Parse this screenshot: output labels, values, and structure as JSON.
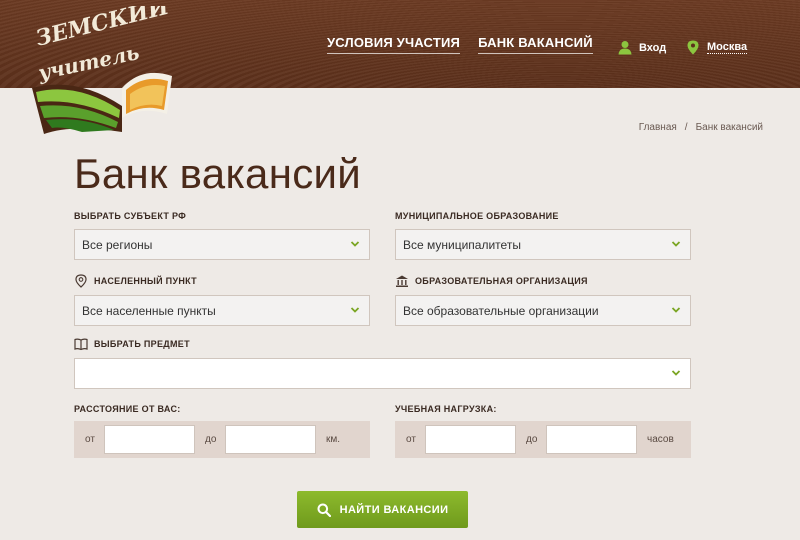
{
  "logo": {
    "text": "Земский учитель"
  },
  "nav": {
    "items": [
      "УСЛОВИЯ УЧАСТИЯ",
      "БАНК ВАКАНСИЙ"
    ]
  },
  "header": {
    "login": "Вход",
    "city": "Москва"
  },
  "breadcrumb": {
    "home": "Главная",
    "separator": "/",
    "current": "Банк вакансий"
  },
  "page_title": "Банк вакансий",
  "filters": {
    "region": {
      "label": "ВЫБРАТЬ СУБЪЕКТ РФ",
      "value": "Все регионы"
    },
    "municipality": {
      "label": "МУНИЦИПАЛЬНОЕ ОБРАЗОВАНИЕ",
      "value": "Все муниципалитеты"
    },
    "locality": {
      "label": "НАСЕЛЕННЫЙ ПУНКТ",
      "value": "Все населенные пункты"
    },
    "organization": {
      "label": "ОБРАЗОВАТЕЛЬНАЯ ОРГАНИЗАЦИЯ",
      "value": "Все образовательные организации"
    },
    "subject": {
      "label": "ВЫБРАТЬ ПРЕДМЕТ",
      "value": ""
    },
    "distance": {
      "label": "РАССТОЯНИЕ ОТ ВАС:",
      "from": "от",
      "to": "до",
      "unit": "км."
    },
    "workload": {
      "label": "УЧЕБНАЯ НАГРУЗКА:",
      "from": "от",
      "to": "до",
      "unit": "часов"
    }
  },
  "search_button": {
    "label": "НАЙТИ ВАКАНСИИ"
  },
  "colors": {
    "header_brown": "#5c301b",
    "accent_green": "#7aa523",
    "range_bg": "#e1d5ce"
  }
}
